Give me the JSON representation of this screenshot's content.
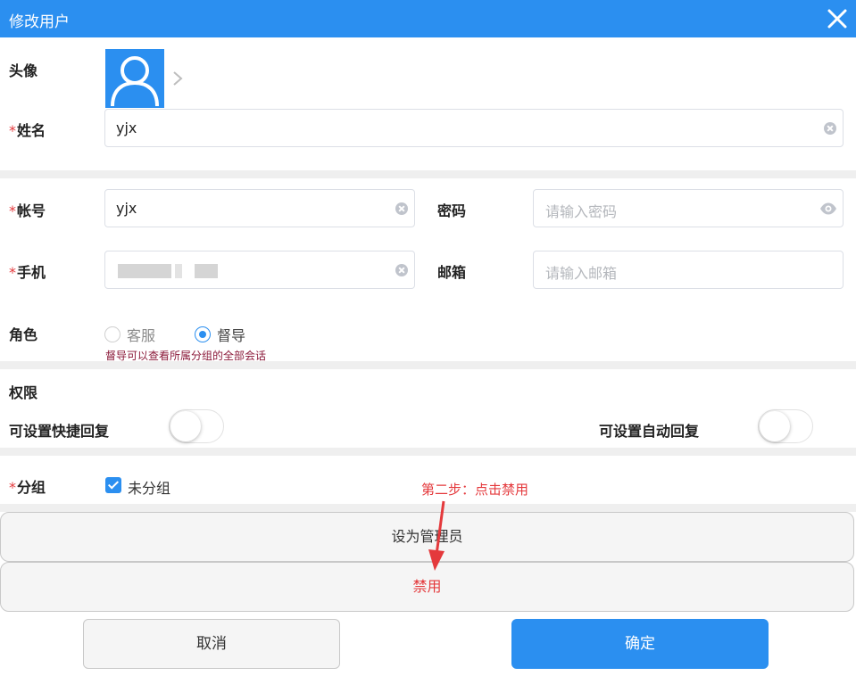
{
  "dialog": {
    "title": "修改用户",
    "close_icon": "close-icon"
  },
  "colors": {
    "primary": "#2b8ff0",
    "required": "#e4393c",
    "hint": "#8b1a3a"
  },
  "form": {
    "avatar": {
      "label": "头像",
      "icon": "user-avatar-icon",
      "chevron": "chevron-right-icon"
    },
    "name": {
      "required_mark": "*",
      "label": "姓名",
      "value": "yjx"
    },
    "account": {
      "required_mark": "*",
      "label": "帐号",
      "value": "yjx"
    },
    "password": {
      "label": "密码",
      "placeholder": "请输入密码",
      "icon": "eye-icon"
    },
    "phone": {
      "required_mark": "*",
      "label": "手机",
      "value_obscured": true
    },
    "email": {
      "label": "邮箱",
      "placeholder": "请输入邮箱"
    },
    "role": {
      "label": "角色",
      "options": [
        {
          "label": "客服",
          "selected": false
        },
        {
          "label": "督导",
          "selected": true
        }
      ],
      "hint": "督导可以查看所属分组的全部会话"
    },
    "permissions": {
      "label": "权限",
      "quick_reply": {
        "label": "可设置快捷回复",
        "enabled": false
      },
      "auto_reply": {
        "label": "可设置自动回复",
        "enabled": false
      }
    },
    "group": {
      "required_mark": "*",
      "label": "分组",
      "option": {
        "label": "未分组",
        "checked": true
      }
    }
  },
  "annotation": {
    "text": "第二步：点击禁用"
  },
  "actions": {
    "set_admin": "设为管理员",
    "disable": "禁用",
    "cancel": "取消",
    "confirm": "确定"
  }
}
